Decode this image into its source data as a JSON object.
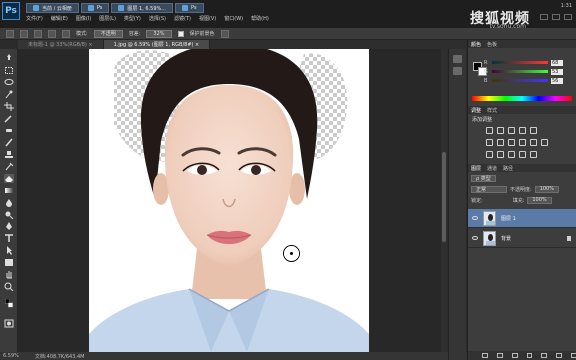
{
  "taskbar": {
    "app_logo": "Ps",
    "tabs": [
      "当前 / 云相册",
      "Ps",
      "图层 1, 6.59%...",
      "Ps"
    ],
    "watermark": "搜狐视频",
    "watermark_sub": "tv.sohu.com",
    "clock": "1:31"
  },
  "menu": {
    "items": [
      "文件(F)",
      "编辑(E)",
      "图像(I)",
      "图层(L)",
      "类型(Y)",
      "选择(S)",
      "滤镜(T)",
      "视图(V)",
      "窗口(W)",
      "帮助(H)"
    ]
  },
  "options_bar": {
    "mode_label": "模式:",
    "mode_value": "不透明",
    "tolerance_label": "容差:",
    "tolerance_value": "32%",
    "protect_fg_label": "保护前景色"
  },
  "doc_tabs": [
    {
      "label": "未标题-1 @ 33%(RGB/8) ×",
      "active": false
    },
    {
      "label": "1.jpg @ 6.59% (图层 1, RGB/8#) ×",
      "active": true
    }
  ],
  "tools": [
    "move-icon",
    "marquee-icon",
    "lasso-icon",
    "quick-select-icon",
    "crop-icon",
    "eyedropper-icon",
    "healing-icon",
    "brush-icon",
    "clone-stamp-icon",
    "history-brush-icon",
    "eraser-icon",
    "gradient-icon",
    "blur-icon",
    "dodge-icon",
    "pen-icon",
    "type-icon",
    "path-select-icon",
    "shape-icon",
    "hand-icon",
    "zoom-icon"
  ],
  "color_panel": {
    "tabs": [
      "颜色",
      "色板"
    ],
    "r_label": "R",
    "r_value": "68",
    "g_label": "G",
    "g_value": "53",
    "b_label": "B",
    "b_value": "56"
  },
  "adjust_panel": {
    "tabs": [
      "调整",
      "样式"
    ],
    "title": "添加调整"
  },
  "layers_panel": {
    "tabs": [
      "图层",
      "通道",
      "路径"
    ],
    "kind_label": "ρ 类型",
    "blend_mode": "正常",
    "opacity_label": "不透明度:",
    "opacity_value": "100%",
    "lock_label": "锁定:",
    "fill_label": "填充:",
    "fill_value": "100%",
    "layers": [
      {
        "name": "图层 1",
        "selected": true
      },
      {
        "name": "背景",
        "selected": false
      }
    ]
  },
  "status": {
    "zoom": "6.59%",
    "doc_info": "文档:408.7K/643.4M"
  },
  "colors": {
    "ui_dark": "#2b2b2b",
    "panel": "#3d3d3d",
    "selected_layer": "#5a7aa8",
    "ps_blue": "#3a8fd0"
  }
}
